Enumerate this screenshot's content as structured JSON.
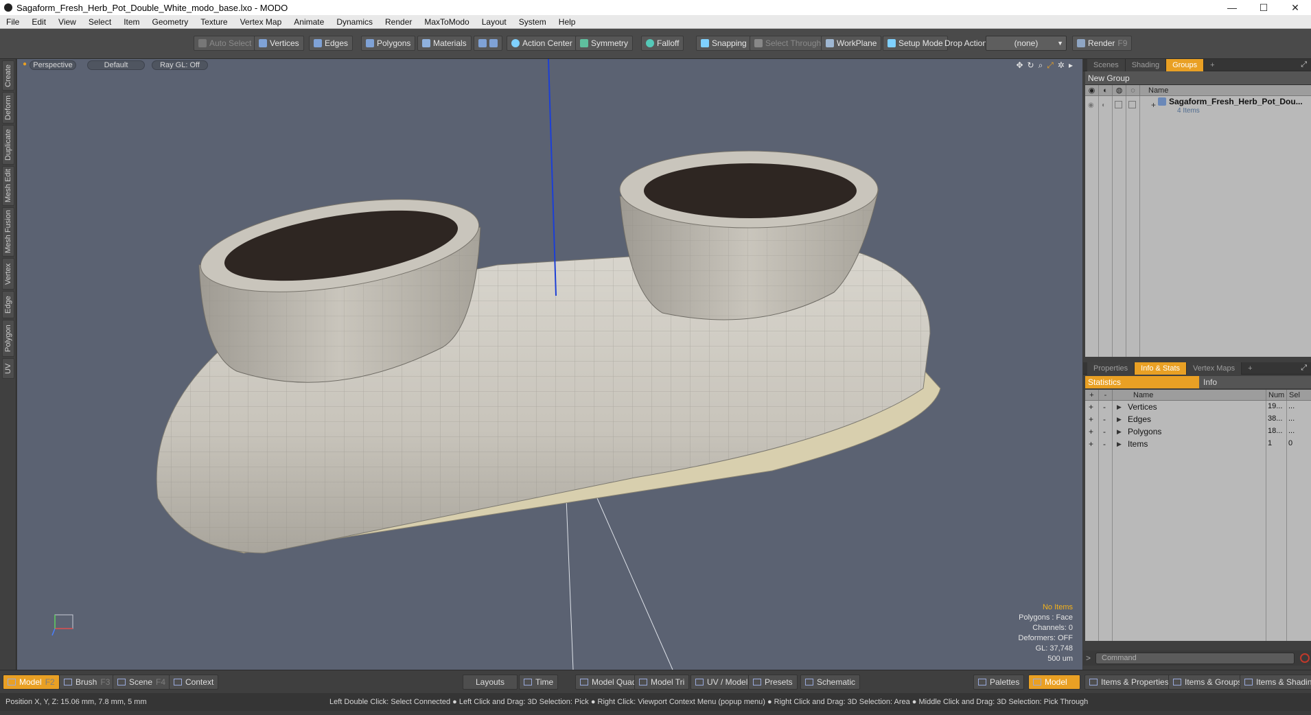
{
  "window": {
    "title": "Sagaform_Fresh_Herb_Pot_Double_White_modo_base.lxo - MODO",
    "minimize": "—",
    "maximize": "☐",
    "close": "✕"
  },
  "menu": [
    "File",
    "Edit",
    "View",
    "Select",
    "Item",
    "Geometry",
    "Texture",
    "Vertex Map",
    "Animate",
    "Dynamics",
    "Render",
    "MaxToModo",
    "Layout",
    "System",
    "Help"
  ],
  "toolbar": {
    "auto_select": "Auto Select",
    "vertices": "Vertices",
    "edges": "Edges",
    "polygons": "Polygons",
    "materials": "Materials",
    "action_center": "Action Center",
    "symmetry": "Symmetry",
    "falloff": "Falloff",
    "snapping": "Snapping",
    "select_through": "Select Through",
    "workplane": "WorkPlane",
    "setup_mode": "Setup Mode",
    "drop_action": "Drop Action",
    "drop_value": "(none)",
    "render": "Render",
    "render_key": "F9"
  },
  "left_tabs": [
    "Create",
    "Deform",
    "Duplicate",
    "Mesh Edit",
    "Mesh Fusion",
    "Vertex",
    "Edge",
    "Polygon",
    "UV"
  ],
  "viewport": {
    "view": "Perspective",
    "shading": "Default",
    "raygl": "Ray GL: Off",
    "stats": {
      "items": "No Items",
      "polygons": "Polygons : Face",
      "channels": "Channels: 0",
      "deformers": "Deformers: OFF",
      "gl": "GL: 37,748",
      "scale": "500 um"
    }
  },
  "groups_panel": {
    "tabs": [
      "Scenes",
      "Shading",
      "Groups"
    ],
    "active_tab": "Groups",
    "new_group": "New Group",
    "col_name": "Name",
    "item_name": "Sagaform_Fresh_Herb_Pot_Dou...",
    "item_count": "4 Items"
  },
  "info_panel": {
    "tabs": [
      "Properties",
      "Info & Stats",
      "Vertex Maps"
    ],
    "active_tab": "Info & Stats",
    "subtabs": [
      "Statistics",
      "Info"
    ],
    "col_name": "Name",
    "col_num": "Num",
    "col_sel": "Sel",
    "rows": [
      {
        "name": "Vertices",
        "num": "19...",
        "sel": "..."
      },
      {
        "name": "Edges",
        "num": "38...",
        "sel": "..."
      },
      {
        "name": "Polygons",
        "num": "18...",
        "sel": "..."
      },
      {
        "name": "Items",
        "num": "1",
        "sel": "0"
      }
    ]
  },
  "command": {
    "placeholder": "Command"
  },
  "bottom": {
    "model": "Model",
    "model_key": "F2",
    "brush": "Brush",
    "brush_key": "F3",
    "scene": "Scene",
    "scene_key": "F4",
    "context": "Context",
    "layouts": "Layouts",
    "time": "Time",
    "model_quad": "Model Quad",
    "model_tri": "Model Tri",
    "uv_model": "UV / Model",
    "presets": "Presets",
    "schematic": "Schematic",
    "palettes": "Palettes",
    "model2": "Model",
    "items_props": "Items & Properties",
    "items_groups": "Items & Groups",
    "items_shading": "Items & Shading"
  },
  "status": {
    "position": "Position X, Y, Z:   15.06 mm, 7.8 mm, 5 mm",
    "hint": "Left Double Click: Select Connected ● Left Click and Drag: 3D Selection: Pick ● Right Click: Viewport Context Menu (popup menu) ● Right Click and Drag: 3D Selection: Area ● Middle Click and Drag: 3D Selection: Pick Through"
  },
  "colors": {
    "accent": "#e9a024",
    "viewport_bg": "#5b6272",
    "model": "#cfcbc2",
    "soil": "#2e2622"
  }
}
